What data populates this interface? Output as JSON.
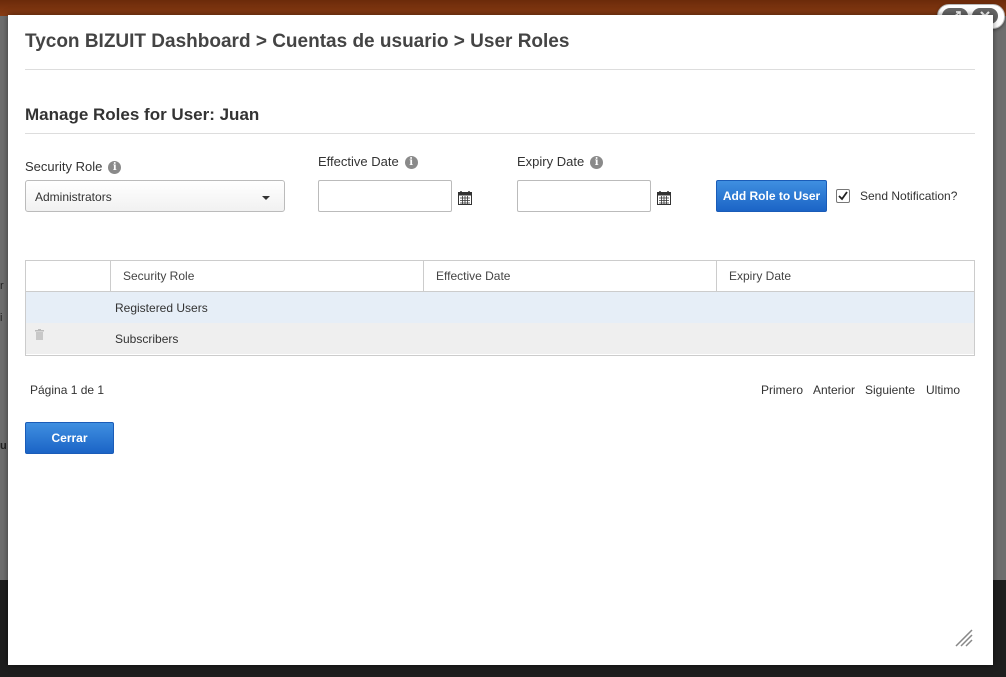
{
  "breadcrumb": "Tycon BIZUIT Dashboard > Cuentas de usuario > User Roles",
  "section_title": "Manage Roles for User: Juan",
  "form": {
    "security_role_label": "Security Role",
    "security_role_value": "Administrators",
    "effective_date_label": "Effective Date",
    "effective_date_value": "",
    "expiry_date_label": "Expiry Date",
    "expiry_date_value": "",
    "add_button": "Add Role to User",
    "send_notification_label": "Send Notification?",
    "send_notification_checked": true
  },
  "grid": {
    "columns": [
      "Security Role",
      "Effective Date",
      "Expiry Date"
    ],
    "rows": [
      {
        "role": "Registered Users",
        "effective": "",
        "expiry": "",
        "deletable": false
      },
      {
        "role": "Subscribers",
        "effective": "",
        "expiry": "",
        "deletable": true
      }
    ]
  },
  "pager": {
    "info": "Página 1 de 1",
    "first": "Primero",
    "prev": "Anterior",
    "next": "Siguiente",
    "last": "Ultimo"
  },
  "close_button": "Cerrar",
  "icons": {
    "maximize": "expand-icon",
    "close": "close-icon",
    "info": "info-icon",
    "calendar": "calendar-icon",
    "delete": "trash-icon",
    "resize": "resize-grip-icon",
    "select_caret": "chevron-down-icon"
  },
  "colors": {
    "primary_button": "#1b64c6",
    "selected_row": "#e6eef7",
    "header_bar": "#7a3414"
  }
}
